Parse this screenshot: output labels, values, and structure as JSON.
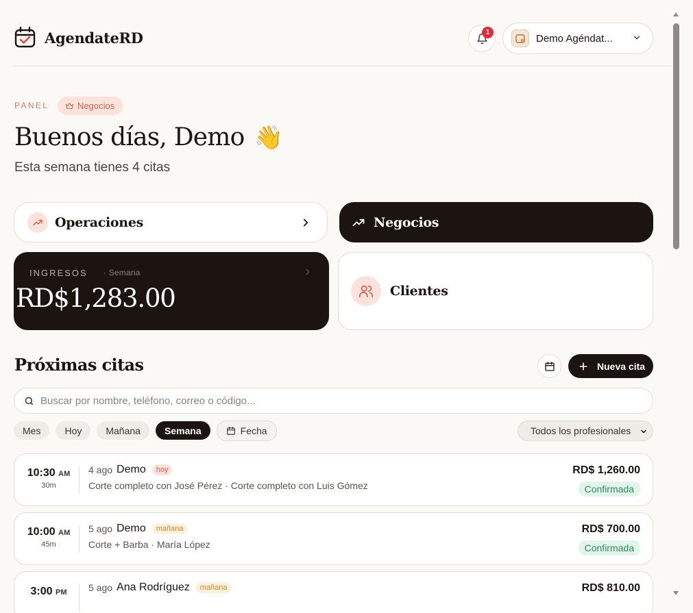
{
  "app": {
    "brand": "AgendateRD",
    "notifications_count": "1",
    "business_name": "Demo Agéndat..."
  },
  "greeting": {
    "panel_label": "PANEL",
    "tier_badge": "Negocios",
    "title": "Buenos días, Demo",
    "emoji": "👋",
    "subtitle": "Esta semana tienes 4 citas"
  },
  "cards": {
    "operations": "Operaciones",
    "business": "Negocios",
    "income_label": "INGRESOS",
    "income_period": "· Semana",
    "income_value": "RD$1,283.00",
    "clients": "Clientes"
  },
  "upcoming": {
    "title": "Próximas citas",
    "new_button": "Nueva cita",
    "search_placeholder": "Buscar por nombre, teléfono, correo o código...",
    "filters": [
      "Mes",
      "Hoy",
      "Mañana",
      "Semana",
      "Fecha"
    ],
    "active_filter": "Semana",
    "professional_select": "Todos los profesionales",
    "appointments": [
      {
        "time": "10:30",
        "ampm": "AM",
        "duration": "30m",
        "date": "4 ago",
        "client": "Demo",
        "tag": "hoy",
        "detail": "Corte completo con José Pérez · Corte completo con Luis Gómez",
        "price": "RD$ 1,260.00",
        "status": "Confirmada"
      },
      {
        "time": "10:00",
        "ampm": "AM",
        "duration": "45m",
        "date": "5 ago",
        "client": "Demo",
        "tag": "mañana",
        "detail": "Corte + Barba · María López",
        "price": "RD$ 700.00",
        "status": "Confirmada"
      },
      {
        "time": "3:00",
        "ampm": "PM",
        "duration": "",
        "date": "5 ago",
        "client": "Ana Rodríguez",
        "tag": "mañana",
        "detail": "",
        "price": "RD$ 810.00",
        "status": ""
      }
    ]
  },
  "colors": {
    "dark": "#1c1411",
    "accent": "#d27a6a",
    "background": "#fbf9f6",
    "confirmed": "#2f8a5e"
  }
}
